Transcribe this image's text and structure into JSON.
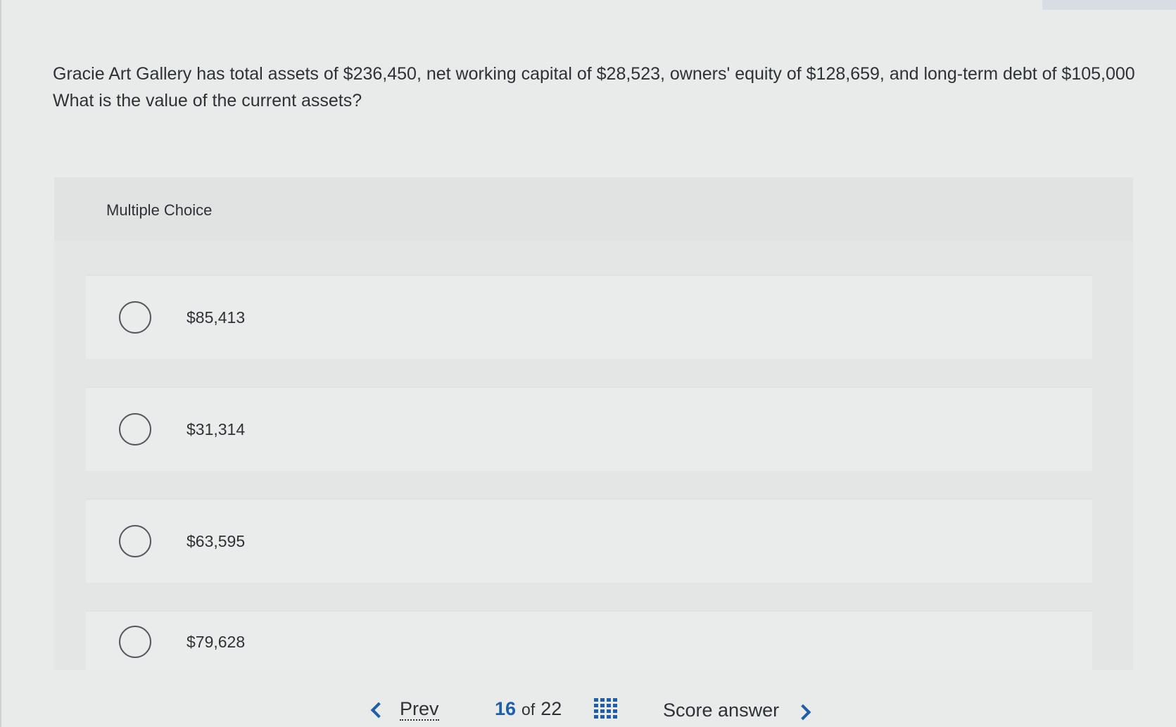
{
  "question": {
    "text": "Gracie Art Gallery has total assets of $236,450, net working capital of $28,523, owners' equity of $128,659, and long-term debt of $105,000 What is the value of the current assets?"
  },
  "multiple_choice": {
    "label": "Multiple Choice",
    "options": [
      {
        "label": "$85,413"
      },
      {
        "label": "$31,314"
      },
      {
        "label": "$63,595"
      },
      {
        "label": "$79,628"
      }
    ]
  },
  "navigation": {
    "prev_label": "Prev",
    "current_page": "16",
    "of_label": "of",
    "total_pages": "22",
    "score_label": "Score answer",
    "accent_color": "#1f5fa8"
  },
  "icons": {
    "prev": "chevron-left-icon",
    "next": "chevron-right-icon",
    "question_map": "grid-icon",
    "radio": "radio-circle-icon"
  }
}
